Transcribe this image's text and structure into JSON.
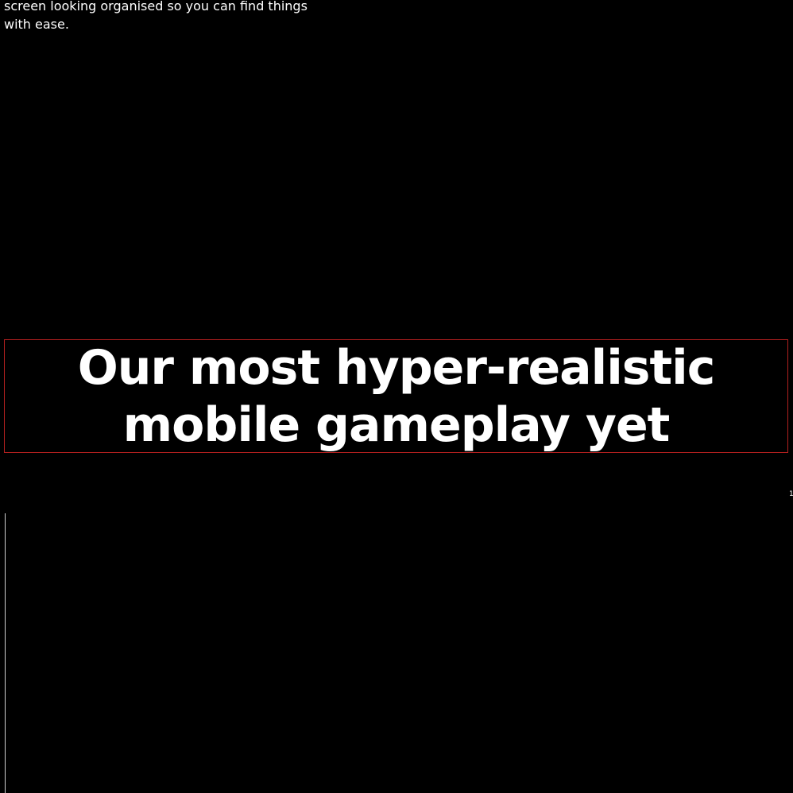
{
  "intro": {
    "text": "screen looking organised so you can find things with ease."
  },
  "headline": {
    "text": "Our most hyper-realistic mobile gameplay yet"
  },
  "page_indicator": {
    "text": "1"
  },
  "colors": {
    "background": "#000000",
    "text": "#ffffff",
    "highlight_border": "#b3201f"
  }
}
